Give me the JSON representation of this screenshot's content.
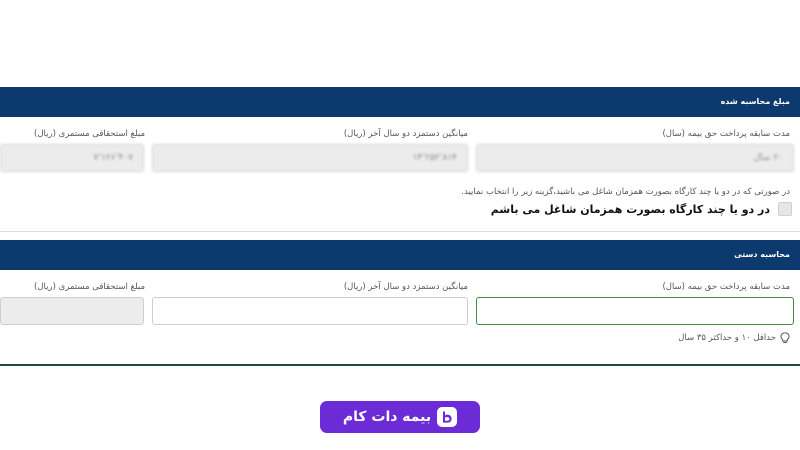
{
  "calculated": {
    "header": "مبلغ محاسبه شده",
    "fields": [
      {
        "label": "مدت سابقه پرداخت حق بیمه (سال)",
        "value": "۲۰ سال"
      },
      {
        "label": "میانگین دستمزد دو سال آخر (ریال)",
        "value": "۱۴٬۲۵۲٬۸۱۴"
      },
      {
        "label": "مبلغ استحقاقی مستمری (ریال)",
        "value": "۷٬۱۲۶٬۴۰۷"
      }
    ],
    "hint": "در صورتی که در دو یا چند کارگاه بصورت همزمان شاغل می باشید،گزینه زیر را انتخاب نمایید.",
    "checkbox_label": "در دو یا چند کارگاه بصورت همزمان شاغل می باشم"
  },
  "manual": {
    "header": "محاسبه دستی",
    "fields": [
      {
        "label": "مدت سابقه پرداخت حق بیمه (سال)",
        "value": ""
      },
      {
        "label": "میانگین دستمزد دو سال آخر (ریال)",
        "value": ""
      },
      {
        "label": "مبلغ استحقاقی مستمری (ریال)",
        "value": ""
      }
    ],
    "help_text": "حداقل ۱۰ و حداکثر ۳۵ سال"
  },
  "logo": {
    "text": "بیمه دات کام",
    "icon": "bimeh-logo-icon",
    "color": "#6b2bd6"
  },
  "colors": {
    "header_bg": "#0d3a6e",
    "active_border": "#3f8a3f"
  }
}
